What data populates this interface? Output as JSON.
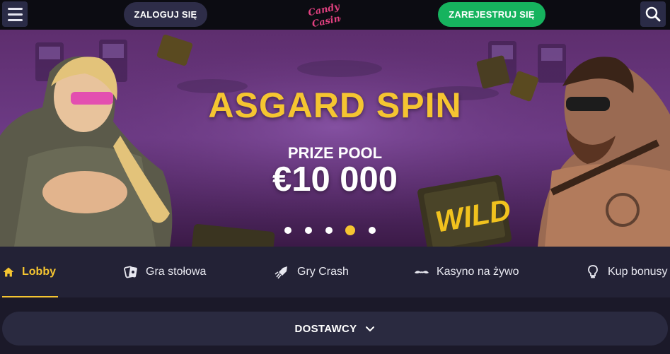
{
  "header": {
    "login_label": "ZALOGUJ SIĘ",
    "register_label": "ZAREJESTRUJ SIĘ",
    "logo_text": [
      "Candy",
      "Casino"
    ],
    "menu_icon": "hamburger-icon",
    "search_icon": "search-icon"
  },
  "banner": {
    "title": "ASGARD SPIN",
    "prize_label": "PRIZE POOL",
    "prize_value": "€10 000",
    "active_slide": 4,
    "slide_count": 5
  },
  "nav": {
    "items": [
      {
        "label": "Lobby",
        "icon": "home-icon",
        "active": true
      },
      {
        "label": "Gra stołowa",
        "icon": "cards-icon",
        "active": false
      },
      {
        "label": "Gry Crash",
        "icon": "rocket-icon",
        "active": false
      },
      {
        "label": "Kasyno na żywo",
        "icon": "mustache-icon",
        "active": false
      },
      {
        "label": "Kup bonusy",
        "icon": "lightbulb-icon",
        "active": false
      }
    ]
  },
  "providers": {
    "label": "DOSTAWCY",
    "icon": "chevron-down-icon"
  },
  "colors": {
    "accent_yellow": "#f5c531",
    "register_green": "#16b35e",
    "header_bg": "#0c0c12",
    "nav_bg": "#232236",
    "page_bg": "#1b1929"
  }
}
